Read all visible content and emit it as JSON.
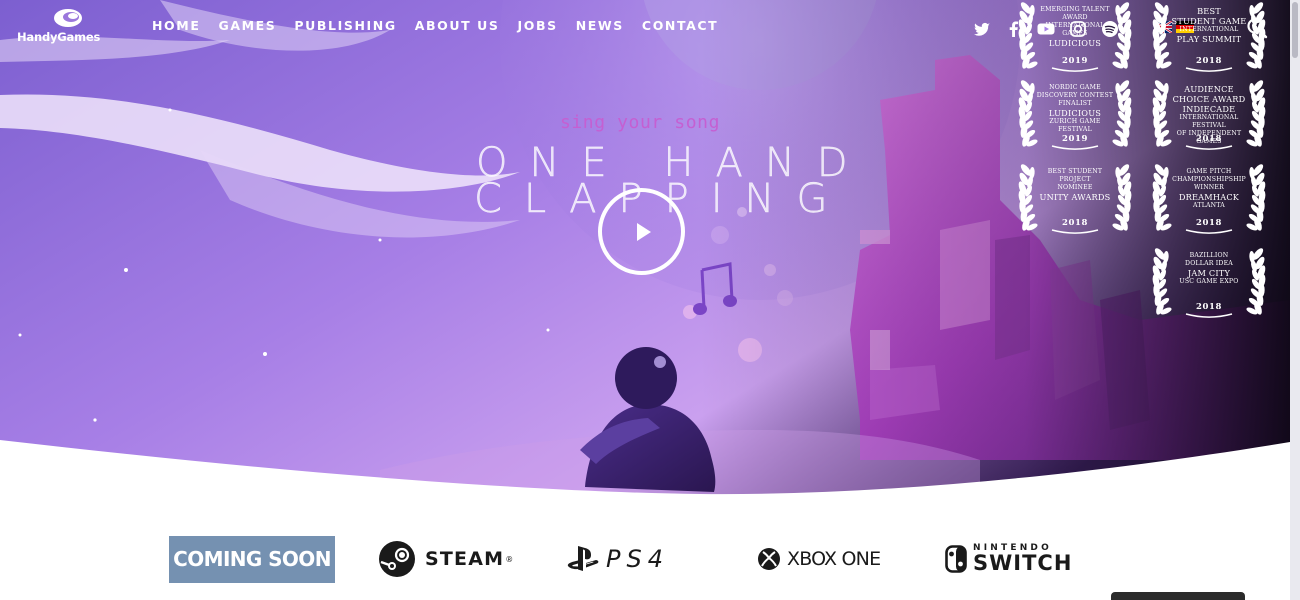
{
  "brand": {
    "logo_text": "HandyGames"
  },
  "nav": {
    "items": [
      "HOME",
      "GAMES",
      "PUBLISHING",
      "ABOUT US",
      "JOBS",
      "NEWS",
      "CONTACT"
    ]
  },
  "social_icons": [
    "twitter-icon",
    "facebook-icon",
    "youtube-icon",
    "instagram-icon",
    "spotify-icon"
  ],
  "language_flags": [
    "uk-flag",
    "germany-flag"
  ],
  "hero": {
    "tagline": "sing your song",
    "title_line1": "ONE HAND",
    "title_line2": "CLAPPING",
    "colors": {
      "sky_top": "#8d6ad6",
      "sky_mid": "#b07ee6",
      "building": "#c855d8",
      "tagline": "#c55fd2"
    }
  },
  "awards": [
    {
      "text": [
        "EMERGING TALENT",
        "AWARD",
        "INTERNATIONAL GAMES",
        "LUDICIOUS"
      ],
      "year": "2019"
    },
    {
      "text": [
        "BEST",
        "STUDENT GAME",
        "INTERNATIONAL",
        "PLAY SUMMIT"
      ],
      "year": "2018"
    },
    {
      "text": [
        "NORDIC GAME",
        "DISCOVERY CONTEST",
        "FINALIST",
        "LUDICIOUS",
        "ZURICH GAME FESTIVAL"
      ],
      "year": "2019"
    },
    {
      "text": [
        "AUDIENCE",
        "CHOICE AWARD",
        "INDIECADE",
        "INTERNATIONAL FESTIVAL",
        "OF INDEPENDENT GAMES"
      ],
      "year": "2018"
    },
    {
      "text": [
        "BEST STUDENT",
        "PROJECT",
        "NOMINEE",
        "UNITY AWARDS"
      ],
      "year": "2018"
    },
    {
      "text": [
        "GAME PITCH",
        "CHAMPIONSHIPSHIP",
        "WINNER",
        "DREAMHACK",
        "ATLANTA"
      ],
      "year": "2018"
    },
    {
      "text": [
        "BAZILLION",
        "DOLLAR IDEA",
        "JAM CITY",
        "USC GAME EXPO"
      ],
      "year": "2018"
    }
  ],
  "platforms": {
    "coming_soon": "COMING SOON",
    "steam": "STEAM",
    "steam_mark": "®",
    "ps4": "PS4",
    "xbox": "XBOX ONE",
    "switch_small": "NINTENDO",
    "switch_big": "SWITCH"
  }
}
